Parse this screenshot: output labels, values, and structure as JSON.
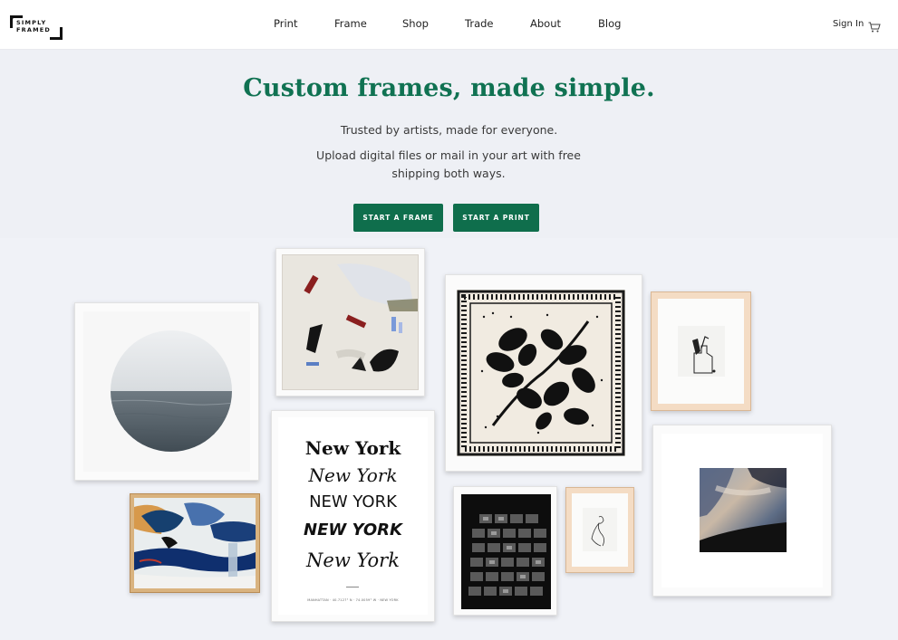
{
  "logo": {
    "line1": "SIMPLY",
    "line2": "FRAMED"
  },
  "nav": {
    "items": [
      {
        "label": "Print"
      },
      {
        "label": "Frame"
      },
      {
        "label": "Shop"
      },
      {
        "label": "Trade"
      },
      {
        "label": "About"
      },
      {
        "label": "Blog"
      }
    ],
    "sign_in": "Sign In",
    "cart_icon": "cart-icon"
  },
  "hero": {
    "headline": "Custom frames, made simple.",
    "tagline": "Trusted by artists, made for everyone.",
    "description": "Upload digital files or mail in your art with free shipping both ways.",
    "buttons": [
      {
        "label": "START A FRAME"
      },
      {
        "label": "START A PRINT"
      }
    ]
  },
  "gallery": {
    "poster_lines": [
      "New York",
      "New York",
      "NEW YORK",
      "NEW YORK",
      "New York"
    ],
    "poster_caption": "MANHATTAN · 40.7127° N · 74.0059° W · NEW YORK"
  },
  "colors": {
    "brand_green": "#107252",
    "button_green": "#0f6e4c",
    "hero_bg": "#eef0f5"
  }
}
